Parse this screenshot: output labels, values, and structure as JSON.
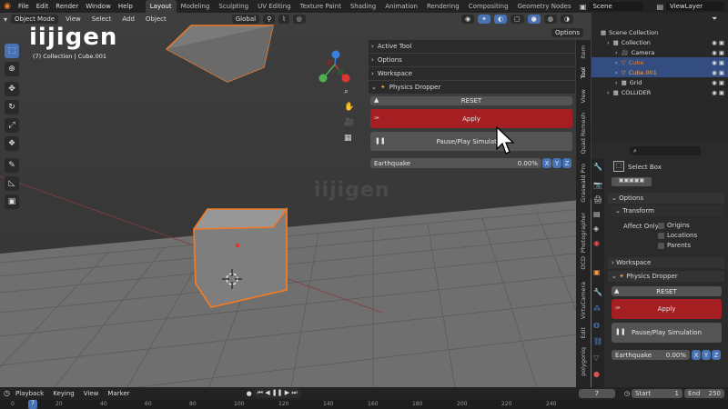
{
  "topbar": {
    "menus": [
      "File",
      "Edit",
      "Render",
      "Window",
      "Help"
    ],
    "workspaces": [
      "Layout",
      "Modeling",
      "Sculpting",
      "UV Editing",
      "Texture Paint",
      "Shading",
      "Animation",
      "Rendering",
      "Compositing",
      "Geometry Nodes"
    ],
    "active_workspace": "Layout",
    "scene": "Scene",
    "view_layer": "ViewLayer"
  },
  "viewport": {
    "mode": "Object Mode",
    "menus": [
      "View",
      "Select",
      "Add",
      "Object"
    ],
    "transform_orientation": "Global",
    "options": "Options",
    "info_line": "(7) Collection | Cube.001",
    "watermark": "iijigen"
  },
  "npanel": {
    "sections": [
      "Active Tool",
      "Options",
      "Workspace"
    ],
    "addon_title": "Physics Dropper",
    "reset": "RESET",
    "apply": "Apply",
    "pause": "Pause/Play Simulation",
    "effect_label": "Earthquake",
    "effect_value": "0.00%",
    "axes": [
      "X",
      "Y",
      "Z"
    ],
    "tabs": [
      "Item",
      "Tool",
      "View",
      "Quad Remesh",
      "Graswald Pro",
      "Photographer",
      "OCD",
      "VirtuCamera",
      "Edit",
      "polygoniq"
    ]
  },
  "outliner": {
    "root": "Scene Collection",
    "items": [
      {
        "label": "Collection",
        "indent": 1,
        "color": "#dddddd"
      },
      {
        "label": "Camera",
        "indent": 2,
        "color": "#dddddd"
      },
      {
        "label": "Cube",
        "indent": 2,
        "color": "#e0813a"
      },
      {
        "label": "Cube.001",
        "indent": 2,
        "color": "#f0a050"
      },
      {
        "label": "Grid",
        "indent": 2,
        "color": "#dddddd"
      },
      {
        "label": "COLLIDER",
        "indent": 1,
        "color": "#dddddd"
      }
    ]
  },
  "properties": {
    "tool_name": "Select Box",
    "options_header": "Options",
    "transform_header": "Transform",
    "affect_only": "Affect Only",
    "checkboxes": [
      "Origins",
      "Locations",
      "Parents"
    ],
    "workspace_header": "Workspace",
    "addon_title": "Physics Dropper",
    "reset": "RESET",
    "apply": "Apply",
    "pause": "Pause/Play Simulation",
    "effect_label": "Earthquake",
    "effect_value": "0.00%"
  },
  "timeline": {
    "menus": [
      "Playback",
      "Keying",
      "View",
      "Marker"
    ],
    "current_frame": "7",
    "start_label": "Start",
    "start": "1",
    "end_label": "End",
    "end": "250",
    "ruler": [
      "0",
      "20",
      "40",
      "60",
      "80",
      "100",
      "120",
      "140",
      "160",
      "180",
      "200",
      "220",
      "240"
    ]
  },
  "colors": {
    "accent": "#4772b3",
    "apply": "#a41e22",
    "select_orange": "#f07a26"
  }
}
